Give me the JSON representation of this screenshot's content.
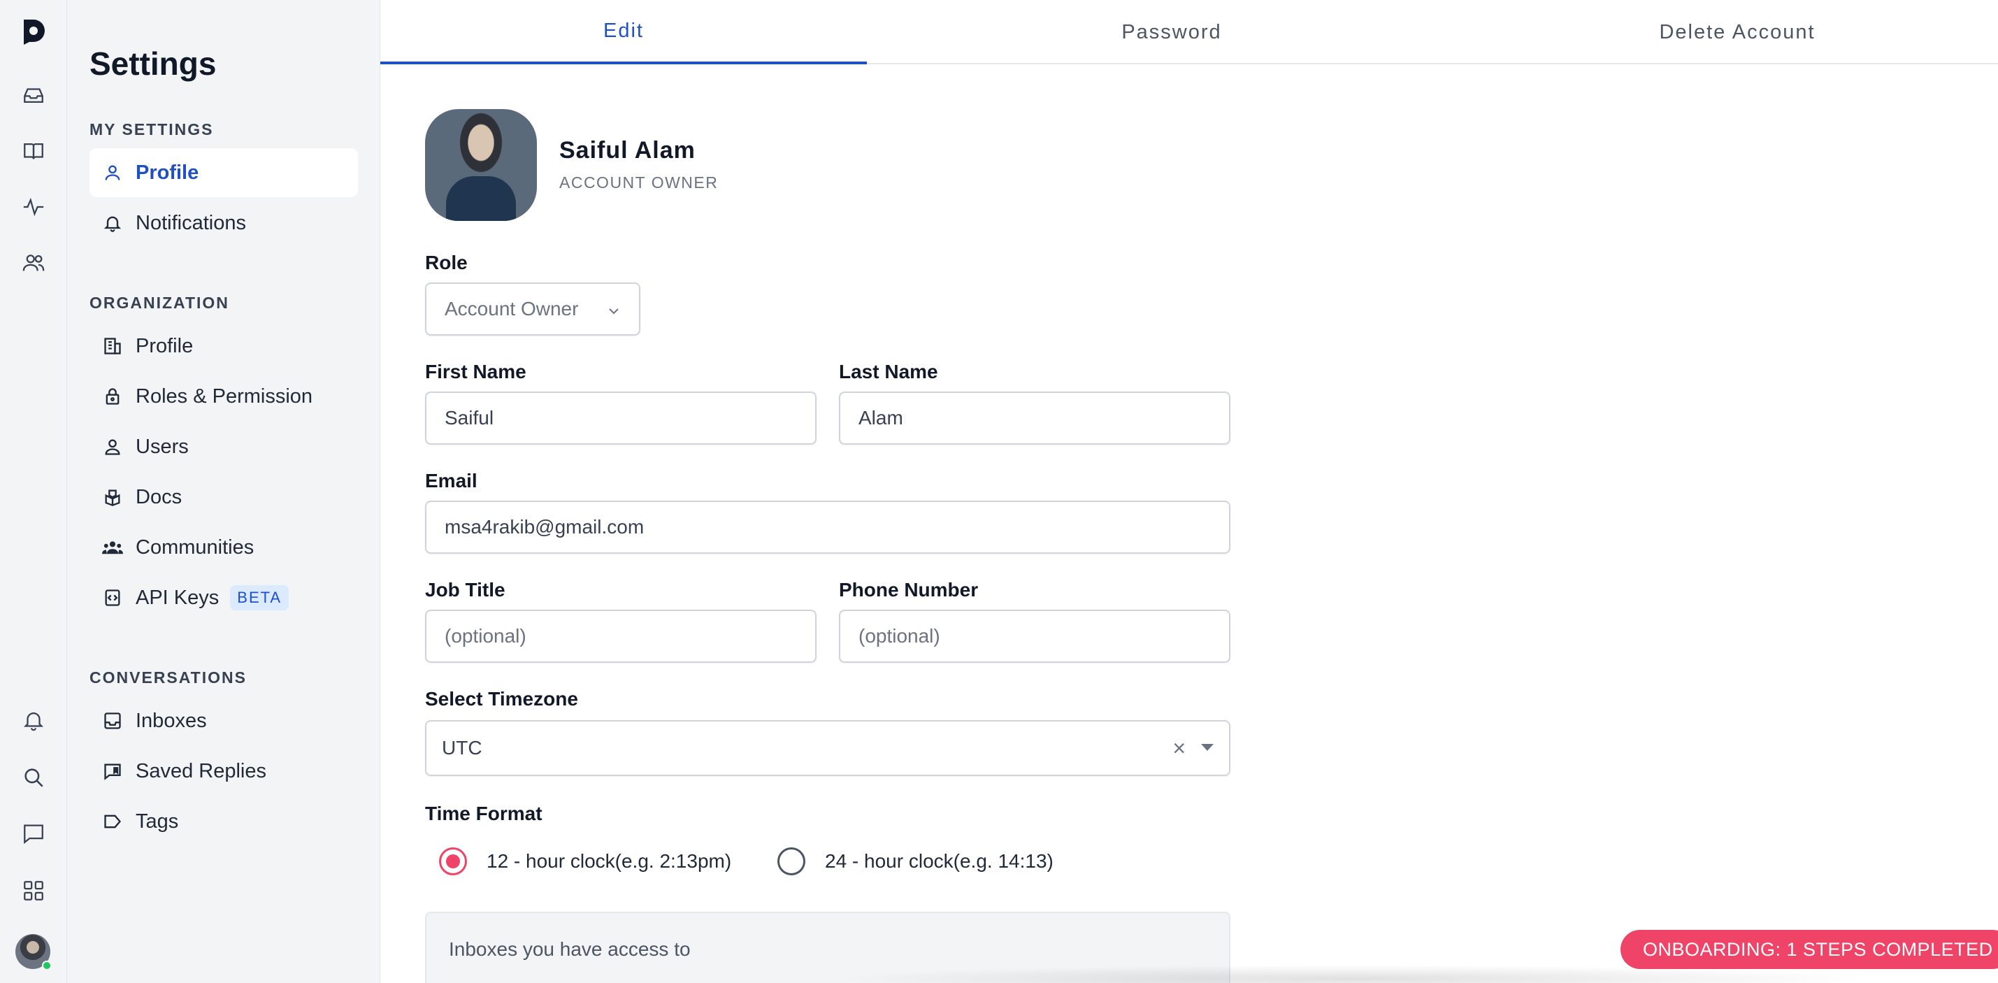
{
  "rail": {
    "logo": "D",
    "top_icons": [
      "inbox-icon",
      "book-icon",
      "activity-icon",
      "users-icon"
    ],
    "bottom_icons": [
      "bell-icon",
      "search-icon",
      "chat-icon",
      "apps-icon"
    ]
  },
  "sidebar": {
    "title": "Settings",
    "my_settings_label": "MY SETTINGS",
    "my_settings": [
      {
        "label": "Profile",
        "icon": "user-icon",
        "active": true
      },
      {
        "label": "Notifications",
        "icon": "bell-icon"
      }
    ],
    "organization_label": "ORGANIZATION",
    "organization": [
      {
        "label": "Profile",
        "icon": "building-icon"
      },
      {
        "label": "Roles & Permission",
        "icon": "lock-icon"
      },
      {
        "label": "Users",
        "icon": "user-icon"
      },
      {
        "label": "Docs",
        "icon": "docs-icon"
      },
      {
        "label": "Communities",
        "icon": "group-icon"
      },
      {
        "label": "API Keys",
        "icon": "code-icon",
        "badge": "BETA"
      }
    ],
    "conversations_label": "CONVERSATIONS",
    "conversations": [
      {
        "label": "Inboxes",
        "icon": "inbox-icon"
      },
      {
        "label": "Saved Replies",
        "icon": "saved-reply-icon"
      },
      {
        "label": "Tags",
        "icon": "tag-icon"
      }
    ]
  },
  "tabs": [
    "Edit",
    "Password",
    "Delete Account"
  ],
  "profile": {
    "name": "Saiful Alam",
    "role_caption": "ACCOUNT OWNER"
  },
  "form": {
    "role_label": "Role",
    "role_value": "Account Owner",
    "first_name_label": "First Name",
    "first_name": "Saiful",
    "last_name_label": "Last Name",
    "last_name": "Alam",
    "email_label": "Email",
    "email": "msa4rakib@gmail.com",
    "job_title_label": "Job Title",
    "job_title_placeholder": "(optional)",
    "phone_label": "Phone Number",
    "phone_placeholder": "(optional)",
    "timezone_label": "Select Timezone",
    "timezone": "UTC",
    "time_format_label": "Time Format",
    "time_format_12": "12 - hour clock(e.g. 2:13pm)",
    "time_format_24": "24 - hour clock(e.g. 14:13)",
    "selected_time_format": "12"
  },
  "inboxes_box": {
    "title": "Inboxes you have access to"
  },
  "onboarding": "ONBOARDING: 1 STEPS COMPLETED",
  "colors": {
    "accent": "#1f51c3",
    "onboarding": "#ef4467"
  }
}
